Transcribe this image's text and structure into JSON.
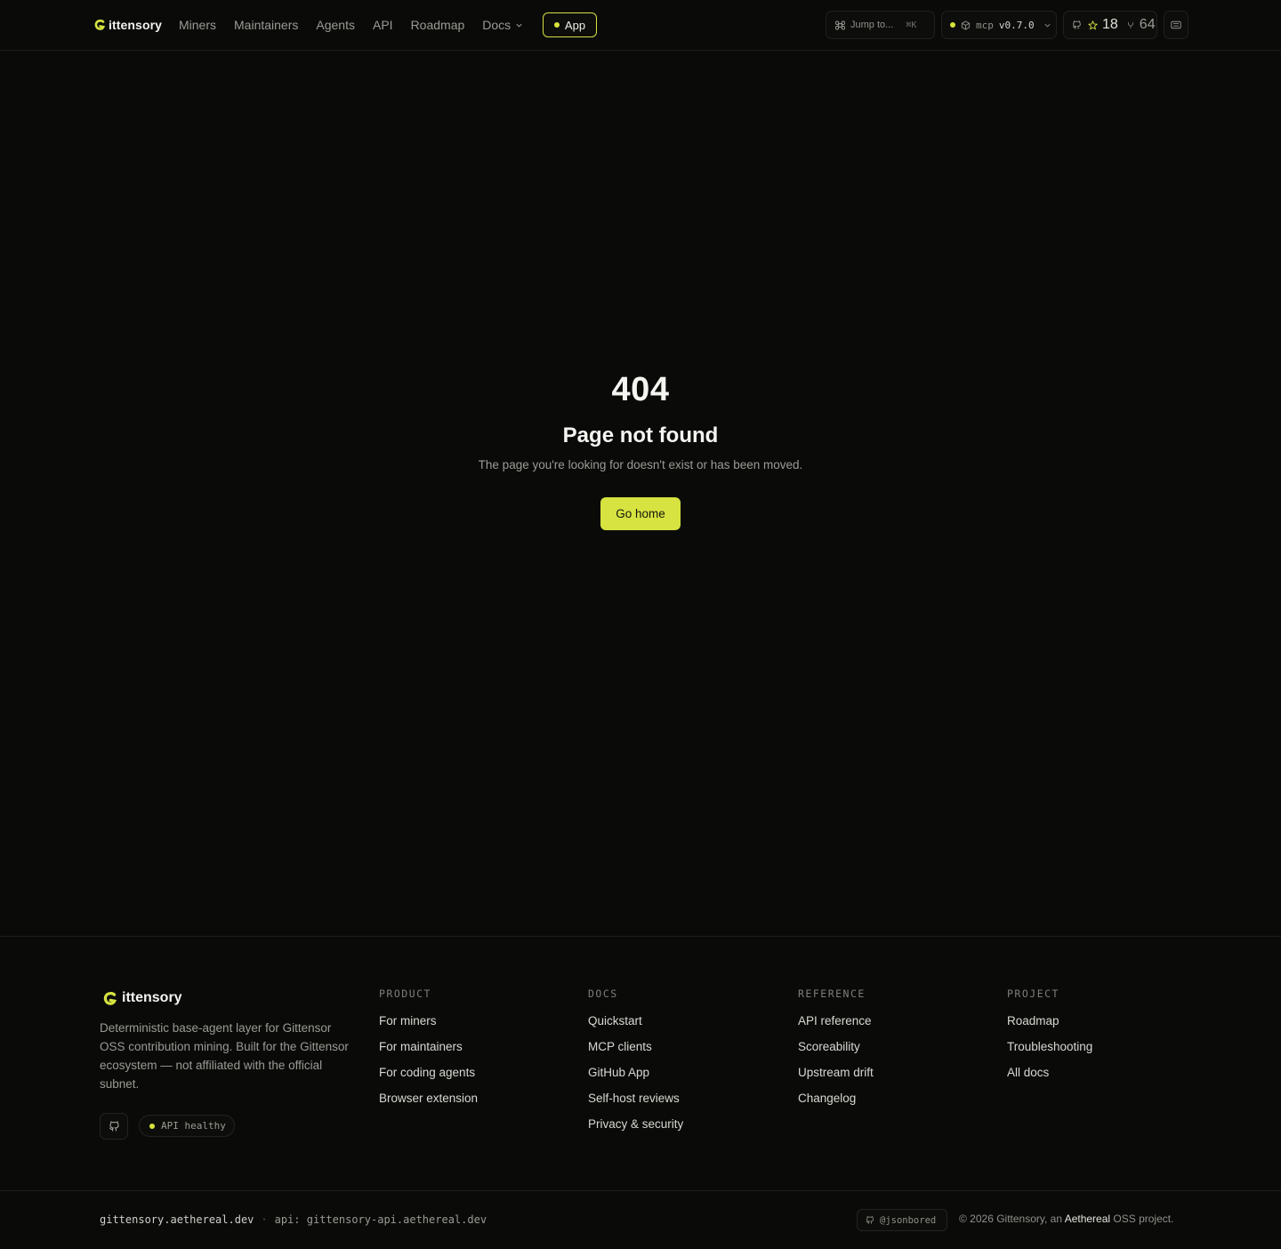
{
  "header": {
    "brand": "ittensory",
    "nav": [
      "Miners",
      "Maintainers",
      "Agents",
      "API",
      "Roadmap"
    ],
    "docs_label": "Docs",
    "app_label": "App",
    "jump_label": "Jump to...",
    "jump_shortcut": "⌘K",
    "mcp_label": "mcp",
    "mcp_version": "v0.7.0",
    "stars": "18",
    "forks": "64"
  },
  "main": {
    "code": "404",
    "title": "Page not found",
    "description": "The page you're looking for doesn't exist or has been moved.",
    "home_label": "Go home"
  },
  "footer": {
    "brand": "ittensory",
    "description": "Deterministic base-agent layer for Gittensor OSS contribution mining. Built for the Gittensor ecosystem — not affiliated with the official subnet.",
    "api_status": "API healthy",
    "columns": [
      {
        "heading": "PRODUCT",
        "links": [
          "For miners",
          "For maintainers",
          "For coding agents",
          "Browser extension"
        ]
      },
      {
        "heading": "DOCS",
        "links": [
          "Quickstart",
          "MCP clients",
          "GitHub App",
          "Self-host reviews",
          "Privacy & security"
        ]
      },
      {
        "heading": "REFERENCE",
        "links": [
          "API reference",
          "Scoreability",
          "Upstream drift",
          "Changelog"
        ]
      },
      {
        "heading": "PROJECT",
        "links": [
          "Roadmap",
          "Troubleshooting",
          "All docs"
        ]
      }
    ],
    "domain": "gittensory.aethereal.dev",
    "separator": "·",
    "api_domain": "api: gittensory-api.aethereal.dev",
    "github_user": "@jsonbored",
    "copyright_prefix": "© 2026 Gittensory, an",
    "copyright_org": "Aethereal",
    "copyright_suffix": "OSS project."
  },
  "colors": {
    "background": "#0a0b09",
    "accent": "#d7e340",
    "muted_text": "#9a9b94"
  },
  "icons": [
    "brand-g-icon",
    "chevron-down-icon",
    "command-icon",
    "cube-icon",
    "github-icon",
    "star-icon",
    "fork-icon",
    "keyboard-icon"
  ]
}
